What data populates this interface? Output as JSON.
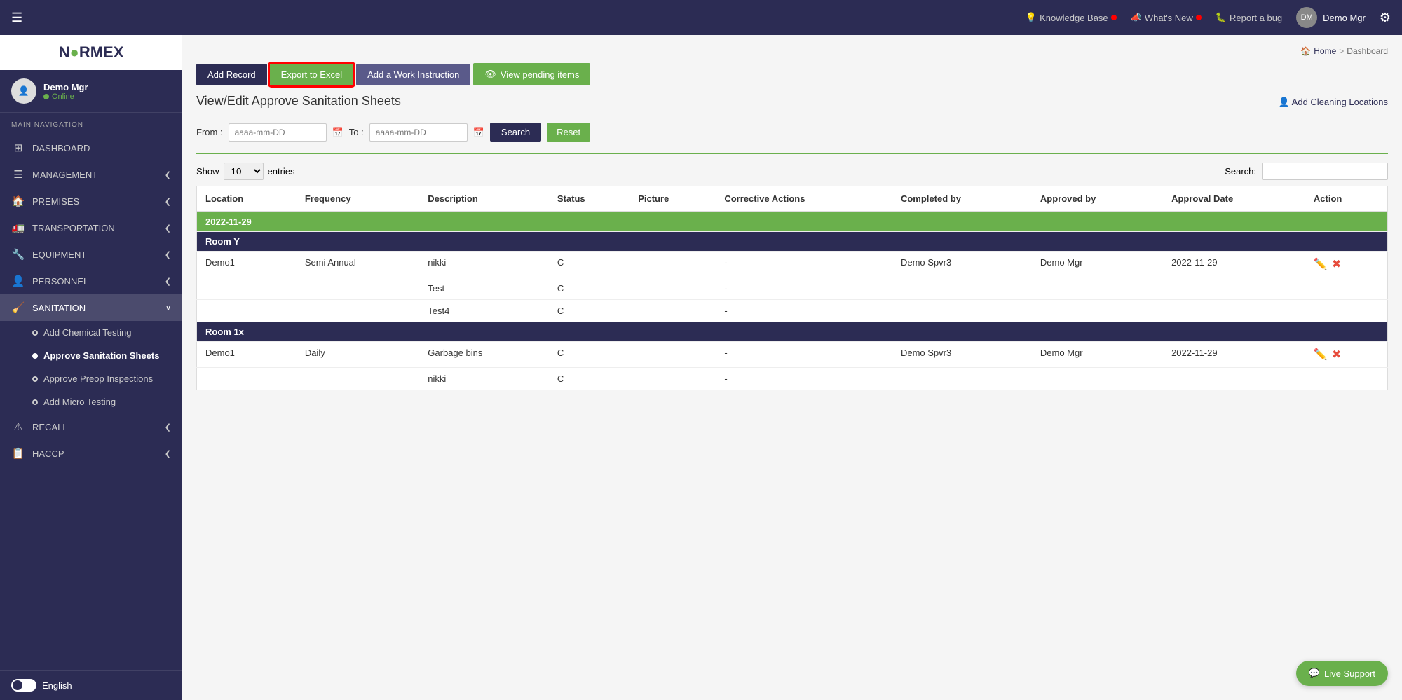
{
  "topbar": {
    "hamburger": "☰",
    "knowledge_base": "Knowledge Base",
    "whats_new": "What's New",
    "report_bug": "Report a bug",
    "user_name": "Demo Mgr",
    "gear": "⚙"
  },
  "sidebar": {
    "logo": "N●RMEX",
    "user": {
      "name": "Demo Mgr",
      "status": "Online"
    },
    "section_label": "MAIN NAVIGATION",
    "items": [
      {
        "id": "dashboard",
        "icon": "⊞",
        "label": "DASHBOARD",
        "has_chevron": false
      },
      {
        "id": "management",
        "icon": "☰",
        "label": "MANAGEMENT",
        "has_chevron": true
      },
      {
        "id": "premises",
        "icon": "🏠",
        "label": "PREMISES",
        "has_chevron": true
      },
      {
        "id": "transportation",
        "icon": "🚛",
        "label": "TRANSPORTATION",
        "has_chevron": true
      },
      {
        "id": "equipment",
        "icon": "🔧",
        "label": "EQUIPMENT",
        "has_chevron": true
      },
      {
        "id": "personnel",
        "icon": "👤",
        "label": "PERSONNEL",
        "has_chevron": true
      },
      {
        "id": "sanitation",
        "icon": "🧹",
        "label": "SANITATION",
        "has_chevron": true
      }
    ],
    "sanitation_sub": [
      {
        "id": "add-chemical",
        "label": "Add Chemical Testing",
        "active": false
      },
      {
        "id": "approve-san",
        "label": "Approve Sanitation Sheets",
        "active": true
      },
      {
        "id": "approve-preinsp",
        "label": "Approve Preop Inspections",
        "active": false
      },
      {
        "id": "add-micro",
        "label": "Add Micro Testing",
        "active": false
      }
    ],
    "items2": [
      {
        "id": "recall",
        "icon": "⚠",
        "label": "RECALL",
        "has_chevron": true
      },
      {
        "id": "haccp",
        "icon": "📋",
        "label": "HACCP",
        "has_chevron": true
      }
    ],
    "language": "English"
  },
  "breadcrumb": {
    "home": "Home",
    "sep": ">",
    "current": "Dashboard"
  },
  "toolbar": {
    "add_record": "Add Record",
    "export_excel": "Export to Excel",
    "add_work_instruction": "Add a Work Instruction",
    "view_pending": "View pending items",
    "eye_icon": "👁"
  },
  "page": {
    "title": "View/Edit Approve Sanitation Sheets",
    "add_cleaning": "Add Cleaning Locations",
    "from_label": "From :",
    "from_placeholder": "aaaa-mm-DD",
    "to_label": "To :",
    "to_placeholder": "aaaa-mm-DD",
    "search_btn": "Search",
    "reset_btn": "Reset",
    "show_label": "Show",
    "show_value": "10",
    "entries_label": "entries",
    "search_label": "Search:",
    "search_placeholder": ""
  },
  "table": {
    "headers": [
      "Location",
      "Frequency",
      "Description",
      "Status",
      "Picture",
      "Corrective Actions",
      "Completed by",
      "Approved by",
      "Approval Date",
      "Action"
    ],
    "groups": [
      {
        "date": "2022-11-29",
        "rooms": [
          {
            "room": "Room Y",
            "rows": [
              {
                "location": "Demo1",
                "frequency": "Semi Annual",
                "description": "nikki",
                "status": "C",
                "picture": "",
                "corrective": "-",
                "completed_by": "Demo Spvr3",
                "approved_by": "Demo Mgr",
                "approval_date": "2022-11-29",
                "has_action": true
              },
              {
                "location": "",
                "frequency": "",
                "description": "Test",
                "status": "C",
                "picture": "",
                "corrective": "-",
                "completed_by": "",
                "approved_by": "",
                "approval_date": "",
                "has_action": false
              },
              {
                "location": "",
                "frequency": "",
                "description": "Test4",
                "status": "C",
                "picture": "",
                "corrective": "-",
                "completed_by": "",
                "approved_by": "",
                "approval_date": "",
                "has_action": false
              }
            ]
          },
          {
            "room": "Room 1x",
            "rows": [
              {
                "location": "Demo1",
                "frequency": "Daily",
                "description": "Garbage bins",
                "status": "C",
                "picture": "",
                "corrective": "-",
                "completed_by": "Demo Spvr3",
                "approved_by": "Demo Mgr",
                "approval_date": "2022-11-29",
                "has_action": true
              },
              {
                "location": "",
                "frequency": "",
                "description": "nikki",
                "status": "C",
                "picture": "",
                "corrective": "-",
                "completed_by": "",
                "approved_by": "",
                "approval_date": "",
                "has_action": false
              }
            ]
          }
        ]
      }
    ]
  },
  "live_support": {
    "icon": "💬",
    "label": "Live Support"
  }
}
